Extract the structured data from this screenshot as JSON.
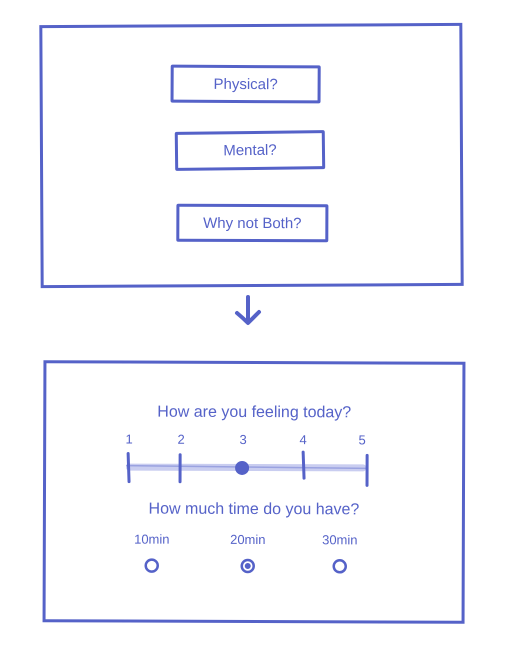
{
  "top_panel": {
    "options": [
      {
        "label": "Physical?"
      },
      {
        "label": "Mental?"
      },
      {
        "label": "Why not Both?"
      }
    ]
  },
  "arrow_icon": "arrow-down-icon",
  "bottom_panel": {
    "feeling": {
      "question": "How are you feeling today?",
      "scale_labels": [
        "1",
        "2",
        "3",
        "4",
        "5"
      ],
      "selected_value": 3
    },
    "time": {
      "question": "How much time do you have?",
      "options": [
        "10min",
        "20min",
        "30min"
      ],
      "selected": "20min"
    }
  },
  "colors": {
    "accent": "#5562c8",
    "track": "#c9cdf0"
  }
}
